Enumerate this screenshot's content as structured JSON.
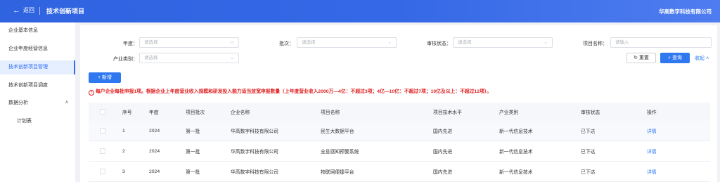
{
  "header": {
    "back_label": "返回",
    "title": "技术创新项目",
    "company": "华高数字科技有限公司"
  },
  "sidebar": {
    "items": [
      {
        "label": "企业基本信息"
      },
      {
        "label": "企业年度经营信息"
      },
      {
        "label": "技术创新项目管理"
      },
      {
        "label": "技术创新项目调度"
      },
      {
        "label": "数据分析"
      },
      {
        "label": "计划表"
      }
    ]
  },
  "filters": {
    "year": {
      "label": "年度：",
      "placeholder": "请选择"
    },
    "batch": {
      "label": "批次：",
      "placeholder": "请选择"
    },
    "status": {
      "label": "审核状态：",
      "placeholder": "请选择"
    },
    "name": {
      "label": "项目名称：",
      "placeholder": "请输入"
    },
    "industry": {
      "label": "产业类别：",
      "placeholder": "请选择"
    }
  },
  "actions": {
    "reset": "重置",
    "search": "查询",
    "collapse": "收起",
    "add": "新增"
  },
  "notice": "每户企业每批申报1项。根据企业上年度营业收入规模和研发投入能力适当放宽申报数量（上年度营业收入2000万—4亿：不超过3项；4亿—10亿：不超过7项；10亿及以上：不超过12项）。",
  "table": {
    "columns": [
      "序号",
      "年度",
      "项目批次",
      "企业名称",
      "项目名称",
      "项目技术水平",
      "产业类别",
      "审核状态",
      "操作"
    ],
    "rows": [
      {
        "index": "1",
        "year": "2024",
        "batch": "第一批",
        "company": "华高数字科技有限公司",
        "project": "民生大数据平台",
        "level": "国内先进",
        "industry": "新一代信息技术",
        "status": "已下达",
        "action": "详情"
      },
      {
        "index": "2",
        "year": "2024",
        "batch": "第一批",
        "company": "华高数字科技有限公司",
        "project": "全息感知预警系统",
        "level": "国内先进",
        "industry": "新一代信息技术",
        "status": "已下达",
        "action": "详情"
      },
      {
        "index": "3",
        "year": "2024",
        "batch": "第一批",
        "company": "华高数字科技有限公司",
        "project": "物联网便捷平台",
        "level": "国内先进",
        "industry": "新一代信息技术",
        "status": "已下达",
        "action": "详情"
      }
    ]
  },
  "colors": {
    "primary": "#2f78f0",
    "header": "#3568e6",
    "danger": "#e02020"
  },
  "icons": {
    "back": "arrow-left-icon",
    "calendar": "calendar-icon",
    "dropdown": "chevron-down-icon",
    "search": "search-icon",
    "reset": "refresh-icon",
    "add": "plus-icon",
    "notice": "alert-circle-icon"
  }
}
